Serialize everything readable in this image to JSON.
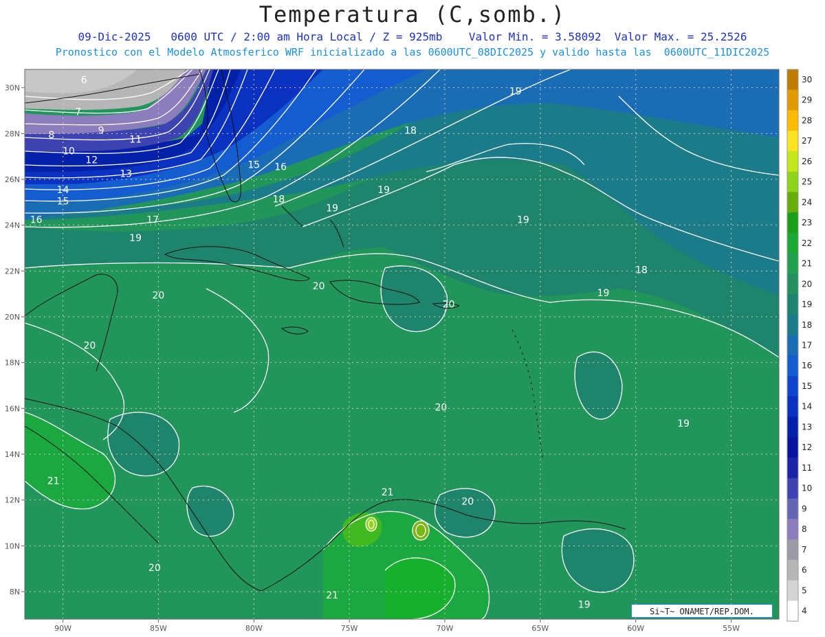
{
  "title": "Temperatura (C,somb.)",
  "subtitle_line1": "09-Dic-2025   0600 UTC / 2:00 am Hora Local / Z = 925mb    Valor Min. = 3.58092  Valor Max. = 25.2526",
  "subtitle_line2": "Pronostico con el Modelo Atmosferico WRF inicializado a las 0600UTC_08DIC2025 y valido hasta las  0600UTC_11DIC2025",
  "credit": "Si~T~ ONAMET/REP.DOM.",
  "map": {
    "lon_range": [
      -92,
      -52.5
    ],
    "lat_range": [
      6.8,
      30.8
    ],
    "lon_ticks": [
      {
        "value": -90,
        "label": "90W"
      },
      {
        "value": -85,
        "label": "85W"
      },
      {
        "value": -80,
        "label": "80W"
      },
      {
        "value": -75,
        "label": "75W"
      },
      {
        "value": -70,
        "label": "70W"
      },
      {
        "value": -65,
        "label": "65W"
      },
      {
        "value": -60,
        "label": "60W"
      },
      {
        "value": -55,
        "label": "55W"
      }
    ],
    "lat_ticks": [
      {
        "value": 8,
        "label": "8N"
      },
      {
        "value": 10,
        "label": "10N"
      },
      {
        "value": 12,
        "label": "12N"
      },
      {
        "value": 14,
        "label": "14N"
      },
      {
        "value": 16,
        "label": "16N"
      },
      {
        "value": 18,
        "label": "18N"
      },
      {
        "value": 20,
        "label": "20N"
      },
      {
        "value": 22,
        "label": "22N"
      },
      {
        "value": 24,
        "label": "24N"
      },
      {
        "value": 26,
        "label": "26N"
      },
      {
        "value": 28,
        "label": "28N"
      },
      {
        "value": 30,
        "label": "30N"
      }
    ],
    "contour_labels": [
      {
        "text": "6",
        "lon": -88.9,
        "lat": 30.2
      },
      {
        "text": "7",
        "lon": -89.2,
        "lat": 28.8
      },
      {
        "text": "8",
        "lon": -90.6,
        "lat": 27.8
      },
      {
        "text": "9",
        "lon": -88.0,
        "lat": 28.0
      },
      {
        "text": "10",
        "lon": -89.7,
        "lat": 27.1
      },
      {
        "text": "11",
        "lon": -86.2,
        "lat": 27.6
      },
      {
        "text": "12",
        "lon": -88.5,
        "lat": 26.7
      },
      {
        "text": "13",
        "lon": -86.7,
        "lat": 26.1
      },
      {
        "text": "14",
        "lon": -90.0,
        "lat": 25.4
      },
      {
        "text": "15",
        "lon": -90.0,
        "lat": 24.9
      },
      {
        "text": "15",
        "lon": -80.0,
        "lat": 26.5
      },
      {
        "text": "16",
        "lon": -91.4,
        "lat": 24.1
      },
      {
        "text": "16",
        "lon": -78.6,
        "lat": 26.4
      },
      {
        "text": "17",
        "lon": -85.3,
        "lat": 24.1
      },
      {
        "text": "18",
        "lon": -78.7,
        "lat": 25.0
      },
      {
        "text": "18",
        "lon": -71.8,
        "lat": 28.0
      },
      {
        "text": "18",
        "lon": -59.7,
        "lat": 21.9
      },
      {
        "text": "19",
        "lon": -66.3,
        "lat": 29.7
      },
      {
        "text": "19",
        "lon": -73.2,
        "lat": 25.4
      },
      {
        "text": "19",
        "lon": -75.9,
        "lat": 24.6
      },
      {
        "text": "19",
        "lon": -86.2,
        "lat": 23.3
      },
      {
        "text": "19",
        "lon": -65.9,
        "lat": 24.1
      },
      {
        "text": "19",
        "lon": -61.7,
        "lat": 20.9
      },
      {
        "text": "19",
        "lon": -57.5,
        "lat": 15.2
      },
      {
        "text": "19",
        "lon": -62.7,
        "lat": 7.3
      },
      {
        "text": "20",
        "lon": -76.6,
        "lat": 21.2
      },
      {
        "text": "20",
        "lon": -69.8,
        "lat": 20.4
      },
      {
        "text": "20",
        "lon": -85.0,
        "lat": 20.8
      },
      {
        "text": "20",
        "lon": -88.6,
        "lat": 18.6
      },
      {
        "text": "20",
        "lon": -70.2,
        "lat": 15.9
      },
      {
        "text": "20",
        "lon": -85.2,
        "lat": 8.9
      },
      {
        "text": "20",
        "lon": -68.8,
        "lat": 11.8
      },
      {
        "text": "21",
        "lon": -90.5,
        "lat": 12.7
      },
      {
        "text": "21",
        "lon": -73.0,
        "lat": 12.2
      },
      {
        "text": "21",
        "lon": -75.9,
        "lat": 7.7
      }
    ]
  },
  "colorbar": {
    "levels": [
      "30",
      "29",
      "28",
      "27",
      "26",
      "25",
      "24",
      "23",
      "22",
      "21",
      "20",
      "19",
      "18",
      "17",
      "16",
      "15",
      "14",
      "13",
      "12",
      "11",
      "10",
      "9",
      "8",
      "7",
      "6",
      "5",
      "4"
    ],
    "colors": [
      "#c07c00",
      "#e19a00",
      "#ffbb00",
      "#fce520",
      "#c4e81c",
      "#8fd41a",
      "#66ad0a",
      "#199f1a",
      "#1ba833",
      "#21a050",
      "#249060",
      "#1e8470",
      "#1b7b88",
      "#1a6db5",
      "#145dd1",
      "#0f45cd",
      "#0a31bf",
      "#0320a8",
      "#0714a0",
      "#1a23a8",
      "#3d44b2",
      "#6266b5",
      "#8c7dbc",
      "#9c9aa6",
      "#b6b6b6",
      "#d5d5d5",
      "#ffffff"
    ]
  }
}
